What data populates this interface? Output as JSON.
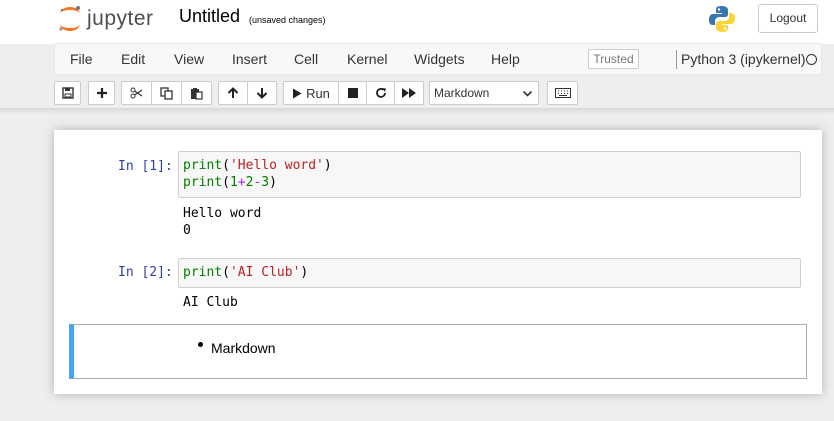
{
  "header": {
    "logo_text": "jupyter",
    "notebook_name": "Untitled",
    "save_status": "(unsaved changes)",
    "logout_label": "Logout"
  },
  "menubar": {
    "items": [
      "File",
      "Edit",
      "View",
      "Insert",
      "Cell",
      "Kernel",
      "Widgets",
      "Help"
    ],
    "trusted_label": "Trusted",
    "kernel_name": "Python 3 (ipykernel)"
  },
  "toolbar": {
    "run_label": "Run",
    "cell_type": "Markdown",
    "icons": [
      "save-icon",
      "plus-icon",
      "cut-icon",
      "copy-icon",
      "paste-icon",
      "arrow-up-icon",
      "arrow-down-icon",
      "play-icon",
      "stop-icon",
      "restart-icon",
      "fast-forward-icon",
      "keyboard-icon"
    ]
  },
  "cells": [
    {
      "prompt": "In [1]:",
      "code_lines": [
        [
          {
            "t": "print",
            "c": "builtin"
          },
          {
            "t": "(",
            "c": "plain"
          },
          {
            "t": "'Hello word'",
            "c": "str"
          },
          {
            "t": ")",
            "c": "plain"
          }
        ],
        [
          {
            "t": "print",
            "c": "builtin"
          },
          {
            "t": "(",
            "c": "plain"
          },
          {
            "t": "1",
            "c": "num"
          },
          {
            "t": "+",
            "c": "op"
          },
          {
            "t": "2",
            "c": "num"
          },
          {
            "t": "-",
            "c": "op"
          },
          {
            "t": "3",
            "c": "num"
          },
          {
            "t": ")",
            "c": "plain"
          }
        ]
      ],
      "output": "Hello word\n0"
    },
    {
      "prompt": "In [2]:",
      "code_lines": [
        [
          {
            "t": "print",
            "c": "builtin"
          },
          {
            "t": "(",
            "c": "plain"
          },
          {
            "t": "'AI Club'",
            "c": "str"
          },
          {
            "t": ")",
            "c": "plain"
          }
        ]
      ],
      "output": "AI Club"
    }
  ],
  "markdown_cell": {
    "bullet_text": "Markdown"
  },
  "colors": {
    "prompt": "#303f9f",
    "selected_cell_bar": "#42a5f5",
    "builtin": "#008000",
    "string": "#ba2121",
    "operator": "#aa22ff"
  }
}
